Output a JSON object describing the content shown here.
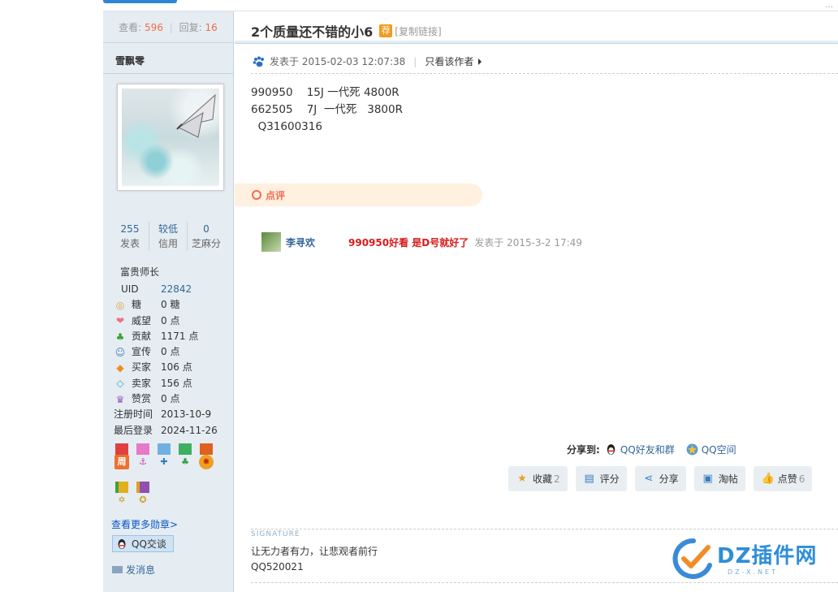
{
  "stats": {
    "view_label": "查看:",
    "views": "596",
    "reply_label": "回复:",
    "replies": "16"
  },
  "author": {
    "name": "雪飘零",
    "counts": [
      {
        "value": "255",
        "label": "发表"
      },
      {
        "value": "较低",
        "label": "信用"
      },
      {
        "value": "0",
        "label": "芝麻分"
      }
    ],
    "rank": "富贵师长",
    "uid_label": "UID",
    "uid": "22842",
    "info": [
      {
        "icon": "sugar-icon",
        "label": "糖",
        "value": "0 糖"
      },
      {
        "icon": "heart-icon",
        "label": "威望",
        "value": "0 点"
      },
      {
        "icon": "sprout-icon",
        "label": "贡献",
        "value": "1171 点"
      },
      {
        "icon": "user-add-icon",
        "label": "宣传",
        "value": "0 点"
      },
      {
        "icon": "diamond-orange-icon",
        "label": "买家",
        "value": "106 点"
      },
      {
        "icon": "diamond-blue-icon",
        "label": "卖家",
        "value": "156 点"
      },
      {
        "icon": "crown-icon",
        "label": "赞赏",
        "value": "0 点"
      },
      {
        "icon": "",
        "label": "注册时间",
        "value": "2013-10-9"
      },
      {
        "icon": "",
        "label": "最后登录",
        "value": "2024-11-26"
      }
    ],
    "medal_week": "周",
    "more_medals": "查看更多勋章>",
    "qq_chat": "QQ交谈",
    "send_message": "发消息"
  },
  "post": {
    "title": "2个质量还不错的小6",
    "recommend_badge": "荐",
    "copy_link": "[复制链接]",
    "posted_at": "发表于 2015-02-03 12:07:38",
    "only_author": "只看该作者",
    "content_lines": [
      "990950    15J 一代死 4800R",
      "662505    7J  一代死   3800R",
      "  Q31600316"
    ]
  },
  "review": {
    "header": "点评",
    "comments": [
      {
        "user": "李寻欢",
        "text": "990950好看 是D号就好了",
        "time": "发表于 2015-3-2 17:49"
      }
    ]
  },
  "share": {
    "label": "分享到:",
    "items": [
      {
        "label": "QQ好友和群"
      },
      {
        "label": "QQ空间"
      }
    ]
  },
  "actions": [
    {
      "icon": "star-icon",
      "label": "收藏",
      "count": "2"
    },
    {
      "icon": "rate-icon",
      "label": "评分",
      "count": ""
    },
    {
      "icon": "share-icon",
      "label": "分享",
      "count": ""
    },
    {
      "icon": "taotie-icon",
      "label": "淘帖",
      "count": ""
    },
    {
      "icon": "thumbs-up-icon",
      "label": "点赞",
      "count": "6"
    }
  ],
  "signature": {
    "label": "SIGNATURE",
    "lines": [
      "让无力者有力，让悲观者前行",
      "QQ520021"
    ]
  },
  "watermark": {
    "text": "DZ插件网",
    "sub": "DZ-X.NET"
  },
  "colors": {
    "accent": "#2f86d6",
    "sidebar_bg": "#e5edf2",
    "count_orange": "#f26c4f",
    "comment_red": "#d91b1b",
    "link": "#336699"
  }
}
